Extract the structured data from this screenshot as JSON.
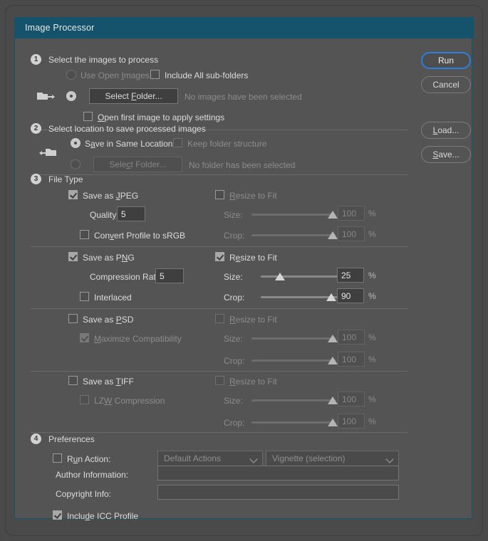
{
  "window": {
    "title": "Image Processor"
  },
  "buttons": {
    "run": "Run",
    "cancel": "Cancel",
    "load": "Load...",
    "save": "Save..."
  },
  "section1": {
    "number": "1",
    "heading": "Select the images to process",
    "use_open_images": "Use Open Images",
    "include_subfolders": "Include All sub-folders",
    "select_folder": "Select Folder...",
    "folder_status": "No images have been selected",
    "open_first_image": "Open first image to apply settings",
    "folder_icon": "folder-out-icon"
  },
  "section2": {
    "number": "2",
    "heading": "Select location to save processed images",
    "save_same_location": "Save in Same Location",
    "keep_folder_structure": "Keep folder structure",
    "select_folder": "Select Folder...",
    "folder_status": "No folder has been selected",
    "folder_icon": "folder-in-icon"
  },
  "section3": {
    "number": "3",
    "heading": "File Type",
    "jpeg": {
      "save_label": "Save as JPEG",
      "quality_label": "Quality:",
      "quality_value": "5",
      "convert_srgb": "Convert Profile to sRGB",
      "resize_label": "Resize to Fit",
      "size_label": "Size:",
      "size_value": "100",
      "crop_label": "Crop:",
      "crop_value": "100",
      "percent": "%"
    },
    "png": {
      "save_label": "Save as PNG",
      "compression_label": "Compression Rate:",
      "compression_value": "5",
      "interlaced": "Interlaced",
      "resize_label": "Resize to Fit",
      "size_label": "Size:",
      "size_value": "25",
      "crop_label": "Crop:",
      "crop_value": "90",
      "percent": "%"
    },
    "psd": {
      "save_label": "Save as PSD",
      "maximize_compat": "Maximize Compatibility",
      "resize_label": "Resize to Fit",
      "size_label": "Size:",
      "size_value": "100",
      "crop_label": "Crop:",
      "crop_value": "100",
      "percent": "%"
    },
    "tiff": {
      "save_label": "Save as TIFF",
      "lzw": "LZW Compression",
      "resize_label": "Resize to Fit",
      "size_label": "Size:",
      "size_value": "100",
      "crop_label": "Crop:",
      "crop_value": "100",
      "percent": "%"
    }
  },
  "section4": {
    "number": "4",
    "heading": "Preferences",
    "run_action": "Run Action:",
    "action_set": "Default Actions",
    "action_name": "Vignette (selection)",
    "author_label": "Author Information:",
    "author_value": "",
    "copyright_label": "Copyright Info:",
    "copyright_value": "",
    "include_icc": "Include ICC Profile"
  },
  "colors": {
    "titlebar": "#14536b",
    "panel": "#545454",
    "accent": "#2a7fe0",
    "text": "#dcdcdc",
    "text_dim": "#8c8c8c"
  }
}
